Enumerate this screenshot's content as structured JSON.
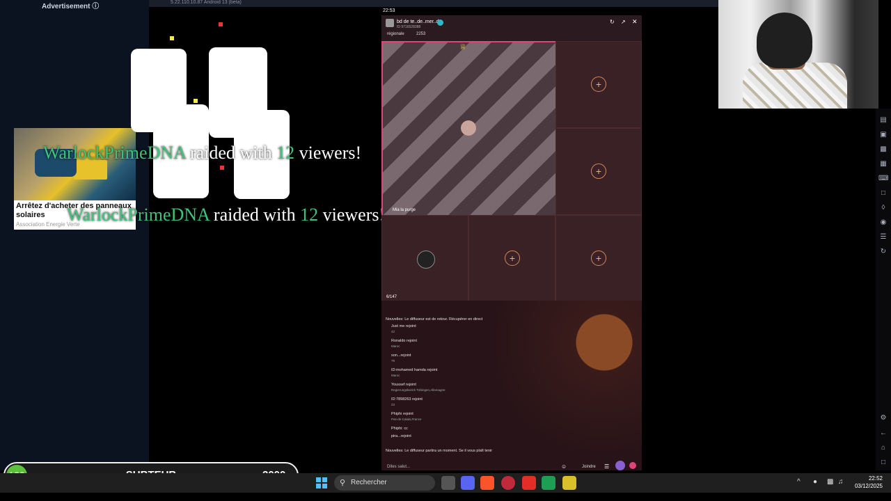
{
  "ad": {
    "header": "Advertisement ⓘ",
    "title": "Arrêtez d'acheter des panneaux solaires",
    "source": "Association Energie Verte"
  },
  "browser": {
    "url_text": "5.22.110.10.87  Android 13 (beta)"
  },
  "raid": {
    "line1": {
      "name": "WarlockPrimeDNA",
      "text1": " raided with ",
      "count": "12",
      "text2": " viewers!"
    },
    "line2": {
      "name": "WarlockPrimeDNA",
      "text1": " raided with ",
      "count": "12",
      "text2": " viewers!"
    }
  },
  "phone": {
    "status_time": "22:53",
    "room_name": "bd de te..de..mer..de",
    "room_sub": "ID 9716528388",
    "room_tag": "régionale",
    "room_count": "2253",
    "main_user": "Mia la purge",
    "listeners": "6/147",
    "chat": [
      {
        "text": "Nouvelles: Le diffuseur est de retour. Récupérer en direct",
        "sub": ""
      },
      {
        "text": "Just me rejoint",
        "sub": "42"
      },
      {
        "text": "Ronaldo rejoint",
        "sub": "Maroc"
      },
      {
        "text": "son...rejoint",
        "sub": "79"
      },
      {
        "text": "ID:mohamed hamda rejoint",
        "sub": "Maroc"
      },
      {
        "text": "Youssef rejoint",
        "sub": "Regierungsbezirk Tübingen,Allemagne"
      },
      {
        "text": "ID:7898263 rejoint",
        "sub": "23"
      },
      {
        "text": "Phiphi rejoint",
        "sub": "Pas-de-Calais,France"
      },
      {
        "text": "Phiphi: cc",
        "sub": ""
      },
      {
        "text": "pira...rejoint",
        "sub": ""
      },
      {
        "text": "Nouvelles: Le diffuseur partira un moment. Se il vous plaît tenir",
        "sub": ""
      }
    ],
    "input_placeholder": "Dites salut...",
    "join_label": "Joindre"
  },
  "subgoal": {
    "current": "120",
    "label": "SUBTEUB",
    "target": "2000",
    "progress_fraction": 0.06
  },
  "taskbar": {
    "search_placeholder": "Rechercher",
    "time": "22:52",
    "date": "03/12/2025"
  },
  "colors": {
    "raid_name": "#3fc37a",
    "subgoal_badge": "#5cc23e",
    "accent_pink": "#e0457a"
  },
  "icons": [
    "windows-start-icon",
    "search-icon",
    "file-explorer-icon",
    "discord-icon",
    "brave-icon",
    "opera-icon",
    "youtube-icon",
    "sheets-icon",
    "app-icon",
    "chevron-up-icon",
    "mic-icon",
    "monitor-icon",
    "speaker-icon"
  ]
}
